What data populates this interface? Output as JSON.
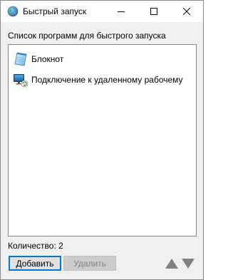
{
  "window": {
    "title": "Быстрый запуск",
    "buttons": {
      "minimize_icon": "minimize-icon",
      "maximize_icon": "maximize-icon",
      "close_icon": "close-icon"
    }
  },
  "main": {
    "list_caption": "Список программ для быстрого запуска",
    "items": [
      {
        "label": "Блокнот",
        "icon": "notepad-icon"
      },
      {
        "label": "Подключение к удаленному рабочему",
        "icon": "remote-desktop-icon"
      }
    ],
    "count_text": "Количество: 2"
  },
  "footer": {
    "add_label": "Добавить",
    "remove_label": "Удалить",
    "move_up_icon": "arrow-up-icon",
    "move_down_icon": "arrow-down-icon"
  },
  "colors": {
    "accent": "#0078d7",
    "window_bg": "#f0f0f0",
    "arrow_gray": "#808080"
  }
}
